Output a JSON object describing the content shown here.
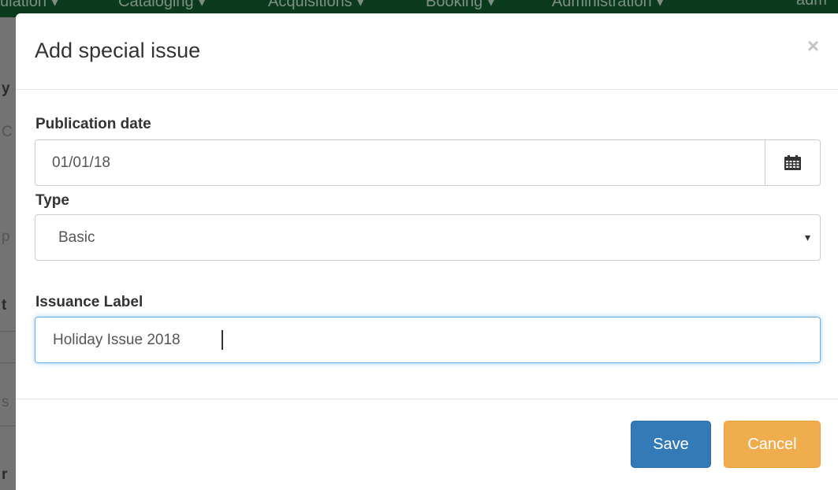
{
  "background": {
    "nav_items": [
      "ulation ▾",
      "Cataloging ▾",
      "Acquisitions ▾",
      "Booking ▾",
      "Administration ▾",
      "adm"
    ],
    "side_glyphs": [
      "y",
      "C",
      "p",
      "t",
      "s",
      "r"
    ]
  },
  "modal": {
    "title": "Add special issue",
    "close_glyph": "×",
    "publication_date": {
      "label": "Publication date",
      "value": "01/01/18",
      "icon": "calendar-icon"
    },
    "type": {
      "label": "Type",
      "selected": "Basic",
      "caret": "▾"
    },
    "issuance_label": {
      "label": "Issuance Label",
      "value": "Holiday Issue 2018"
    },
    "buttons": {
      "save": "Save",
      "cancel": "Cancel"
    }
  },
  "colors": {
    "primary": "#337ab7",
    "warning": "#f0ad4e",
    "focus_border": "#66afe9",
    "nav_bg": "#0c3a1c"
  }
}
